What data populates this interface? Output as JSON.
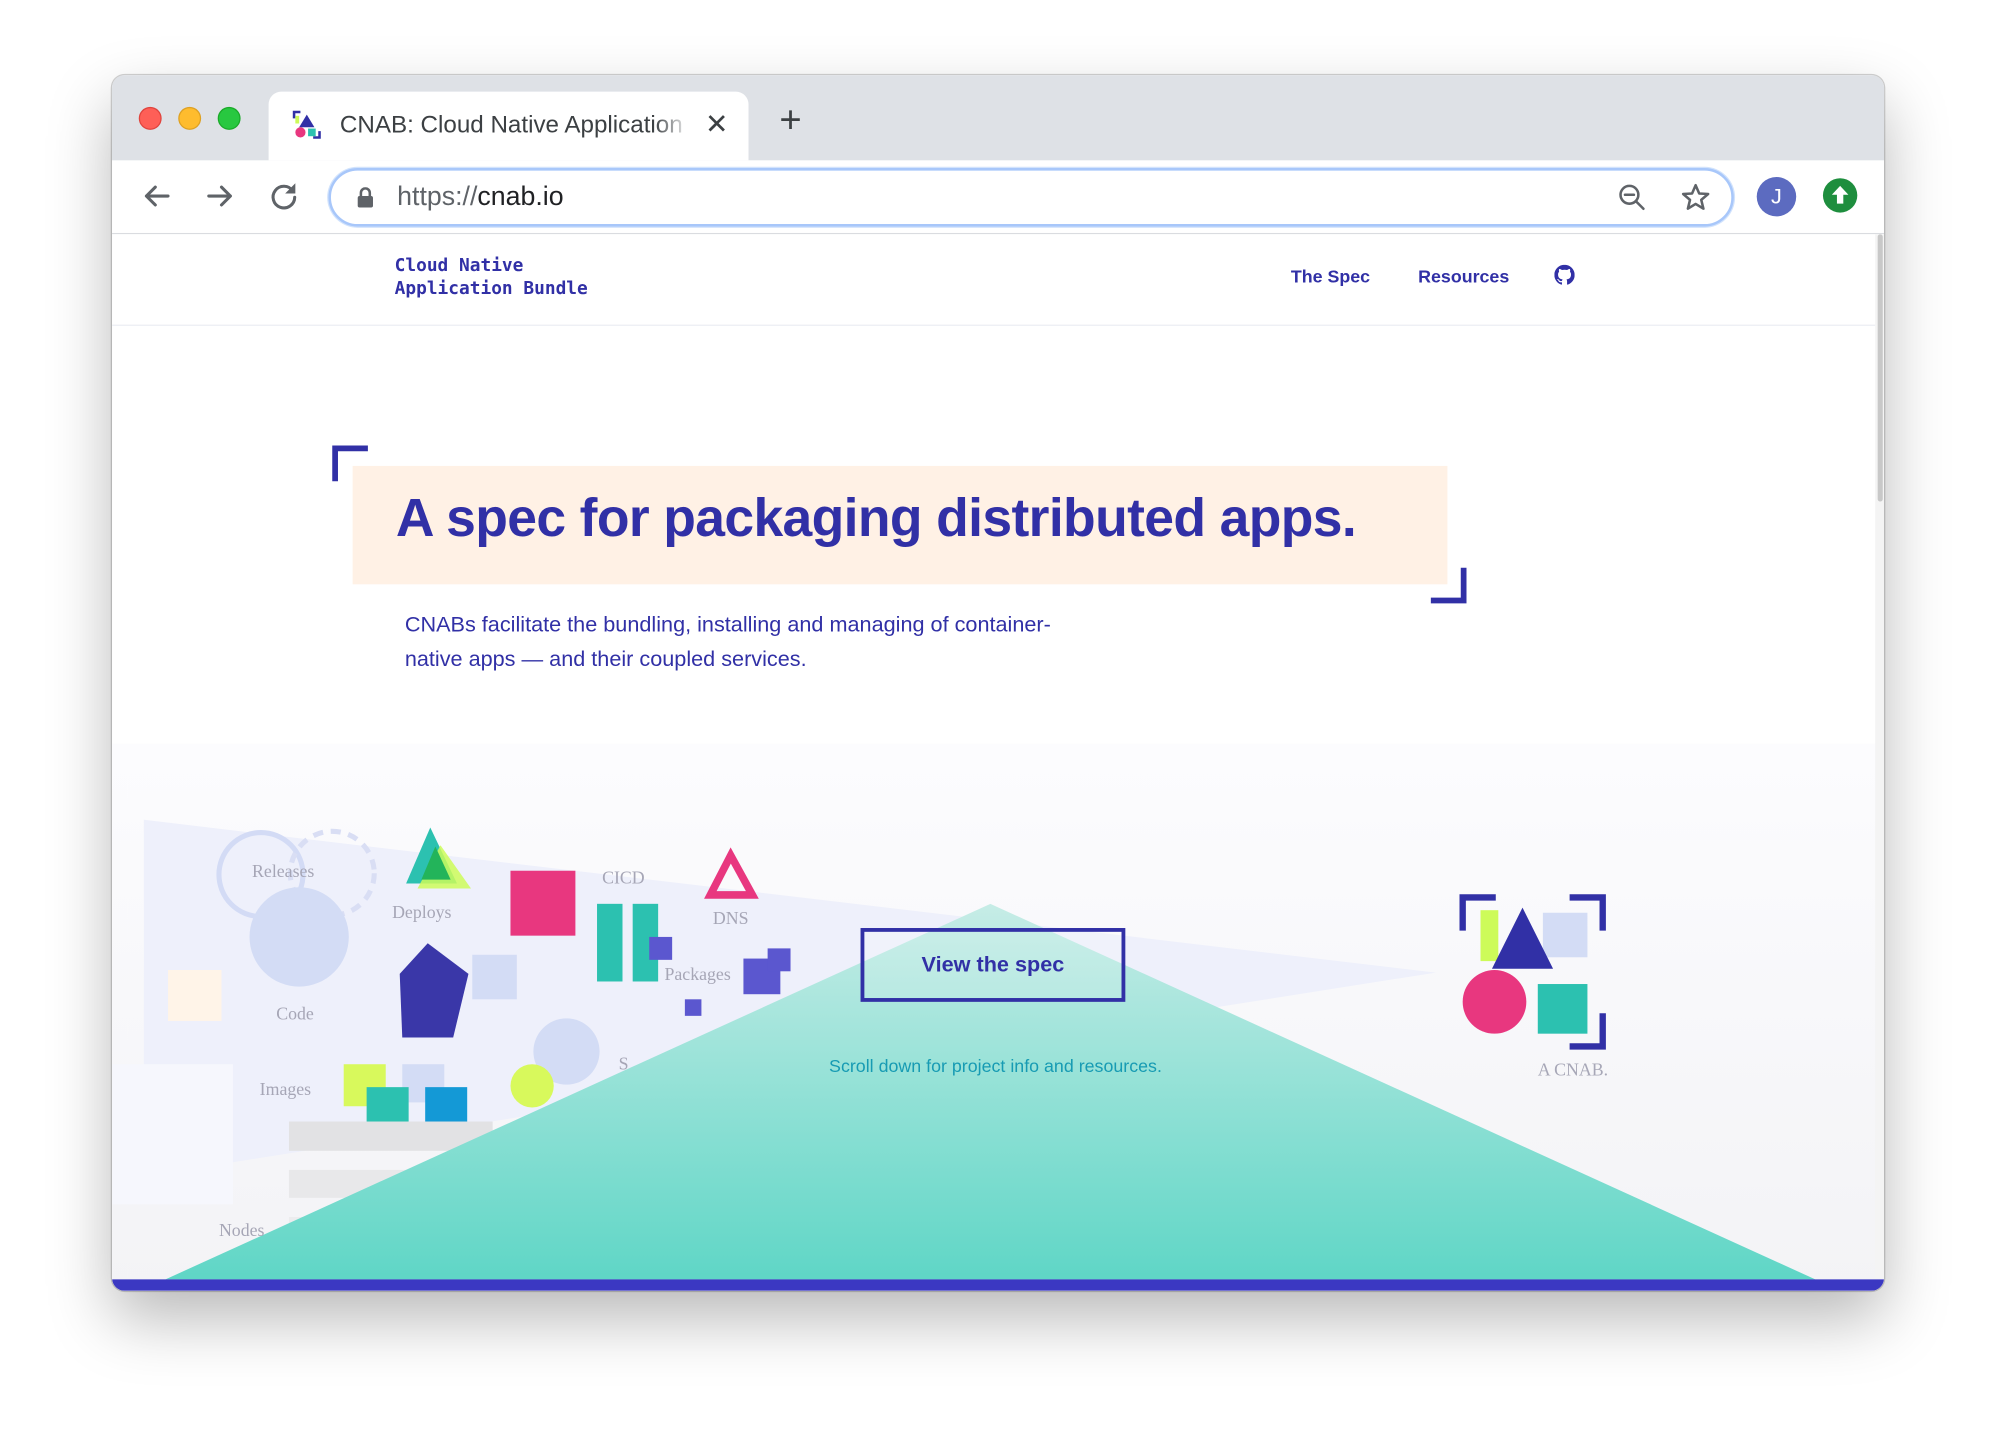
{
  "browser": {
    "tab_title": "CNAB: Cloud Native Application Bundle",
    "url_scheme": "https://",
    "url_host": "cnab.io",
    "avatar_letter": "J",
    "icons": [
      "back-icon",
      "forward-icon",
      "reload-icon",
      "lock-icon",
      "zoom-out-icon",
      "star-icon",
      "update-icon",
      "close-icon",
      "plus-icon"
    ]
  },
  "site": {
    "brand_line1": "Cloud Native",
    "brand_line2": "Application Bundle",
    "nav": {
      "spec": "The Spec",
      "resources": "Resources"
    }
  },
  "hero": {
    "title": "A spec for packaging distributed apps.",
    "subtitle": "CNABs facilitate the bundling, installing and managing of container-native apps — and their coupled services.",
    "cta": "View the spec",
    "scroll_note": "Scroll down for project info and resources.",
    "cnab_label": "A CNAB."
  },
  "illustration": {
    "labels": {
      "releases": "Releases",
      "deploys": "Deploys",
      "cicd": "CICD",
      "dns": "DNS",
      "packages": "Packages",
      "code": "Code",
      "images": "Images",
      "nodes": "Nodes",
      "partial_s": "S"
    }
  },
  "colors": {
    "brand": "#3130a6",
    "hero_box": "#fff1e5",
    "teal": "#2cc1b0",
    "pink": "#e8377f",
    "lime": "#cdfb59",
    "accent_bar": "#3b38c2"
  }
}
